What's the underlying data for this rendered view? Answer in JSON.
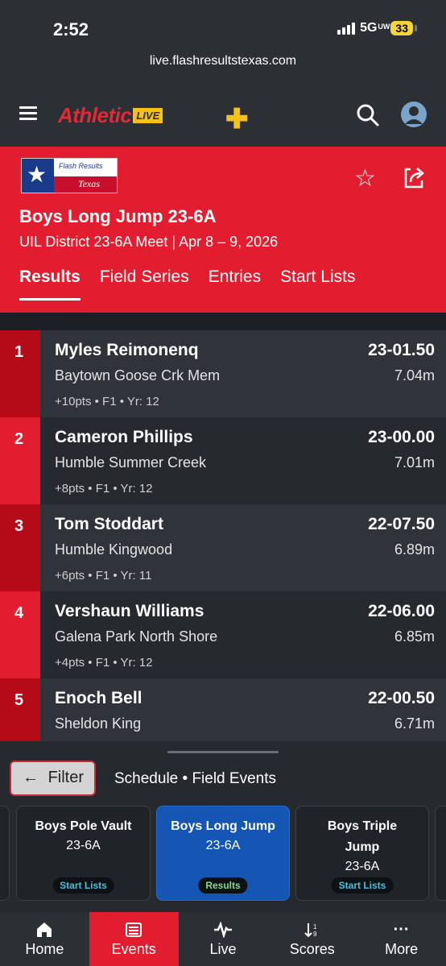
{
  "status": {
    "time": "2:52",
    "network": "5G",
    "network_suffix": "UW",
    "battery": "33"
  },
  "browser": {
    "url": "live.flashresultstexas.com"
  },
  "header": {
    "logo_text": "Athletic",
    "logo_badge": "LIVE"
  },
  "event": {
    "flag_line1": "Flash Results",
    "flag_line2": "Texas",
    "title": "Boys Long Jump 23-6A",
    "subtitle": "UIL District 23-6A Meet | Apr 8 – 9, 2026",
    "tabs": [
      "Results",
      "Field Series",
      "Entries",
      "Start Lists"
    ]
  },
  "results": [
    {
      "place": "1",
      "name": "Myles Reimonenq",
      "team": "Baytown Goose Crk Mem",
      "meta": "+10pts • F1 • Yr: 12",
      "mark": "23-01.50",
      "metric": "7.04m"
    },
    {
      "place": "2",
      "name": "Cameron Phillips",
      "team": "Humble Summer Creek",
      "meta": "+8pts • F1 • Yr: 12",
      "mark": "23-00.00",
      "metric": "7.01m"
    },
    {
      "place": "3",
      "name": "Tom Stoddart",
      "team": "Humble Kingwood",
      "meta": "+6pts • F1 • Yr: 11",
      "mark": "22-07.50",
      "metric": "6.89m"
    },
    {
      "place": "4",
      "name": "Vershaun Williams",
      "team": "Galena Park North Shore",
      "meta": "+4pts • F1 • Yr: 12",
      "mark": "22-06.00",
      "metric": "6.85m"
    },
    {
      "place": "5",
      "name": "Enoch Bell",
      "team": "Sheldon King",
      "meta": "",
      "mark": "22-00.50",
      "metric": "6.71m"
    }
  ],
  "sheet": {
    "filter_label": "Filter",
    "breadcrumb": "Schedule • Field Events",
    "cards": [
      {
        "title": "Boys Pole Vault",
        "division": "23-6A",
        "status": "Start Lists"
      },
      {
        "title": "Boys Long Jump",
        "division": "23-6A",
        "status": "Results"
      },
      {
        "title": "Boys Triple Jump",
        "division": "23-6A",
        "status": "Start Lists"
      }
    ]
  },
  "nav": [
    "Home",
    "Events",
    "Live",
    "Scores",
    "More"
  ],
  "colors": {
    "brand_red": "#e21d2f",
    "selected_card": "#1555b4",
    "header_bg": "#2c2f34"
  }
}
